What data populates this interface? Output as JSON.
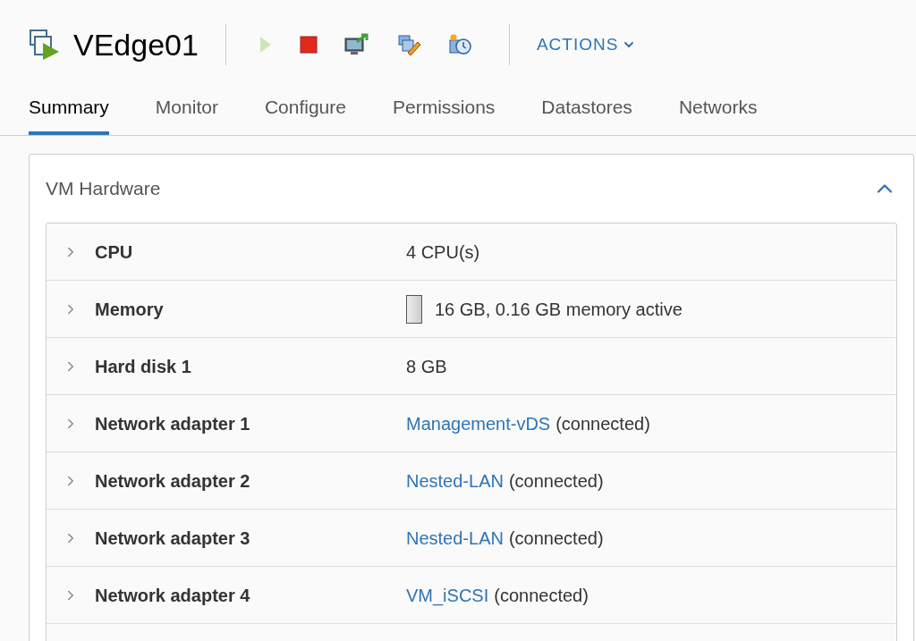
{
  "header": {
    "title": "VEdge01",
    "toolbar": [
      {
        "kind": "power-on",
        "disabled": true
      },
      {
        "kind": "power-off",
        "disabled": false
      },
      {
        "kind": "console",
        "disabled": false
      },
      {
        "kind": "edit",
        "disabled": false
      },
      {
        "kind": "snapshot",
        "disabled": false
      }
    ],
    "actions": "ACTIONS"
  },
  "tabs": [
    {
      "label": "Summary",
      "selected": true
    },
    {
      "label": "Monitor",
      "selected": false
    },
    {
      "label": "Configure",
      "selected": false
    },
    {
      "label": "Permissions",
      "selected": false
    },
    {
      "label": "Datastores",
      "selected": false
    },
    {
      "label": "Networks",
      "selected": false
    }
  ],
  "panel": {
    "title": "VM Hardware",
    "expanded": true,
    "rows": [
      {
        "label": "CPU",
        "expanded": false,
        "value": "4 CPU(s)"
      },
      {
        "label": "Memory",
        "expanded": false,
        "meter": true,
        "value": "16 GB, 0.16 GB memory active"
      },
      {
        "label": "Hard disk 1",
        "expanded": false,
        "value": "8 GB"
      },
      {
        "label": "Network adapter 1",
        "expanded": false,
        "link": "Management-vDS",
        "value": "(connected)"
      },
      {
        "label": "Network adapter 2",
        "expanded": false,
        "link": "Nested-LAN",
        "value": "(connected)"
      },
      {
        "label": "Network adapter 3",
        "expanded": false,
        "link": "Nested-LAN",
        "value": "(connected)"
      },
      {
        "label": "Network adapter 4",
        "expanded": false,
        "link": "VM_iSCSI",
        "value": "(connected)"
      }
    ]
  }
}
